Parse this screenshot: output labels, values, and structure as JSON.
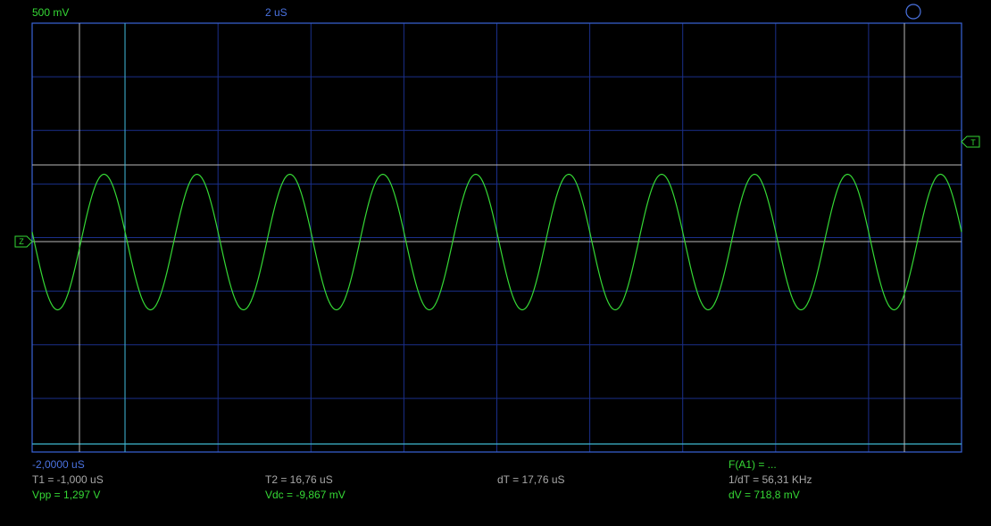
{
  "header": {
    "volts_per_div": "500 mV",
    "time_per_div": "2 uS"
  },
  "markers": {
    "trigger_label": "T",
    "zero_label": "Z"
  },
  "footer": {
    "offset": "-2,0000 uS",
    "t1": "T1 = -1,000 uS",
    "t2": "T2 = 16,76 uS",
    "dt": "dT = 17,76 uS",
    "func": "F(A1) = ...",
    "inv_dt": "1/dT = 56,31 KHz",
    "vpp": "Vpp = 1,297 V",
    "vdc": "Vdc = -9,867 mV",
    "dv": "dV = 718,8 mV"
  },
  "colors": {
    "background": "#000000",
    "grid": "#1a2f8a",
    "frame": "#3a64d8",
    "trace": "#35d835",
    "cursor_white": "#b8b8b8",
    "cursor_cyan": "#3fb8d0",
    "text_green": "#35d835",
    "text_blue": "#4a72e0",
    "text_grey": "#a8a8a8"
  },
  "chart_data": {
    "type": "line",
    "waveform": "sine",
    "grid_divisions": {
      "x": 10,
      "y": 8
    },
    "cursor_time_us": {
      "t1": -1.0,
      "t2": 16.76
    },
    "frequency_khz": 56.31,
    "amplitude_pp_v": 1.297,
    "dc_offset_mv": -9.867,
    "dv_mv": 718.8
  }
}
